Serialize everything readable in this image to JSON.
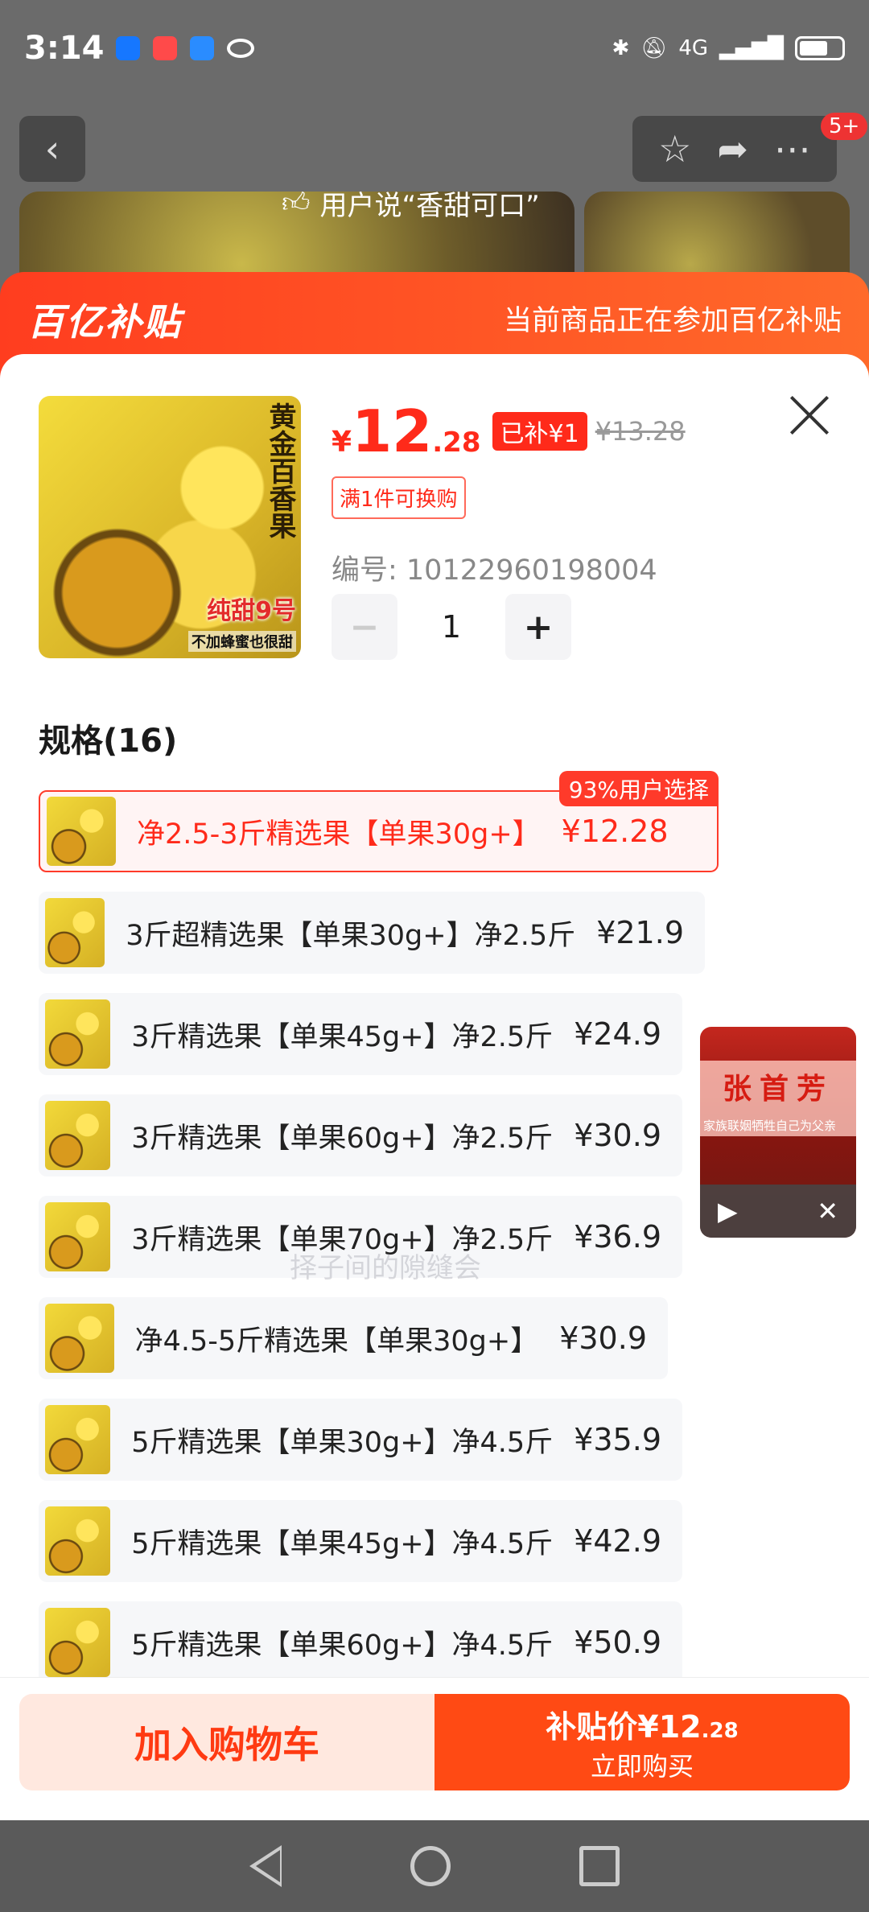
{
  "status": {
    "time": "3:14",
    "network": "4G"
  },
  "background_page": {
    "review_text": "用户说“香甜可口”",
    "notif_badge": "5+"
  },
  "subsidy_bar": {
    "logo": "百亿补贴",
    "note": "当前商品正在参加百亿补贴"
  },
  "product": {
    "image_title": "黄金百香果",
    "image_badge": "纯甜9号",
    "image_note": "不加蜂蜜也很甜",
    "currency": "¥",
    "price_int": "12",
    "price_dec": ".28",
    "subsidized_label": "已补¥1",
    "original_price": "¥13.28",
    "exchange_tag": "满1件可换购",
    "code": "编号: 10122960198004",
    "quantity": "1",
    "minus": "−",
    "plus": "+"
  },
  "spec": {
    "title": "规格(16)",
    "options": [
      {
        "name": "净2.5-3斤精选果【单果30g+】",
        "price": "¥12.28",
        "tag": "93%用户选择",
        "selected": true
      },
      {
        "name": "3斤超精选果【单果30g+】净2.5斤",
        "price": "¥21.9"
      },
      {
        "name": "3斤精选果【单果45g+】净2.5斤",
        "price": "¥24.9"
      },
      {
        "name": "3斤精选果【单果60g+】净2.5斤",
        "price": "¥30.9"
      },
      {
        "name": "3斤精选果【单果70g+】净2.5斤",
        "price": "¥36.9"
      },
      {
        "name": "净4.5-5斤精选果【单果30g+】",
        "price": "¥30.9"
      },
      {
        "name": "5斤精选果【单果30g+】净4.5斤",
        "price": "¥35.9"
      },
      {
        "name": "5斤精选果【单果45g+】净4.5斤",
        "price": "¥42.9"
      },
      {
        "name": "5斤精选果【单果60g+】净4.5斤",
        "price": "¥50.9"
      }
    ]
  },
  "video": {
    "name": "张首芳",
    "subtitle": "家族联姻牺牲自己为父亲",
    "play": "▶",
    "close": "✕"
  },
  "faded_text": "择子间的隙缝会",
  "actions": {
    "cart": "加入购物车",
    "buy_line1": "补贴价¥12",
    "buy_line1_dec": ".28",
    "buy_line2": "立即购买"
  },
  "colors": {
    "accent": "#ff2a1a",
    "subsidy": "#ff4a14"
  }
}
